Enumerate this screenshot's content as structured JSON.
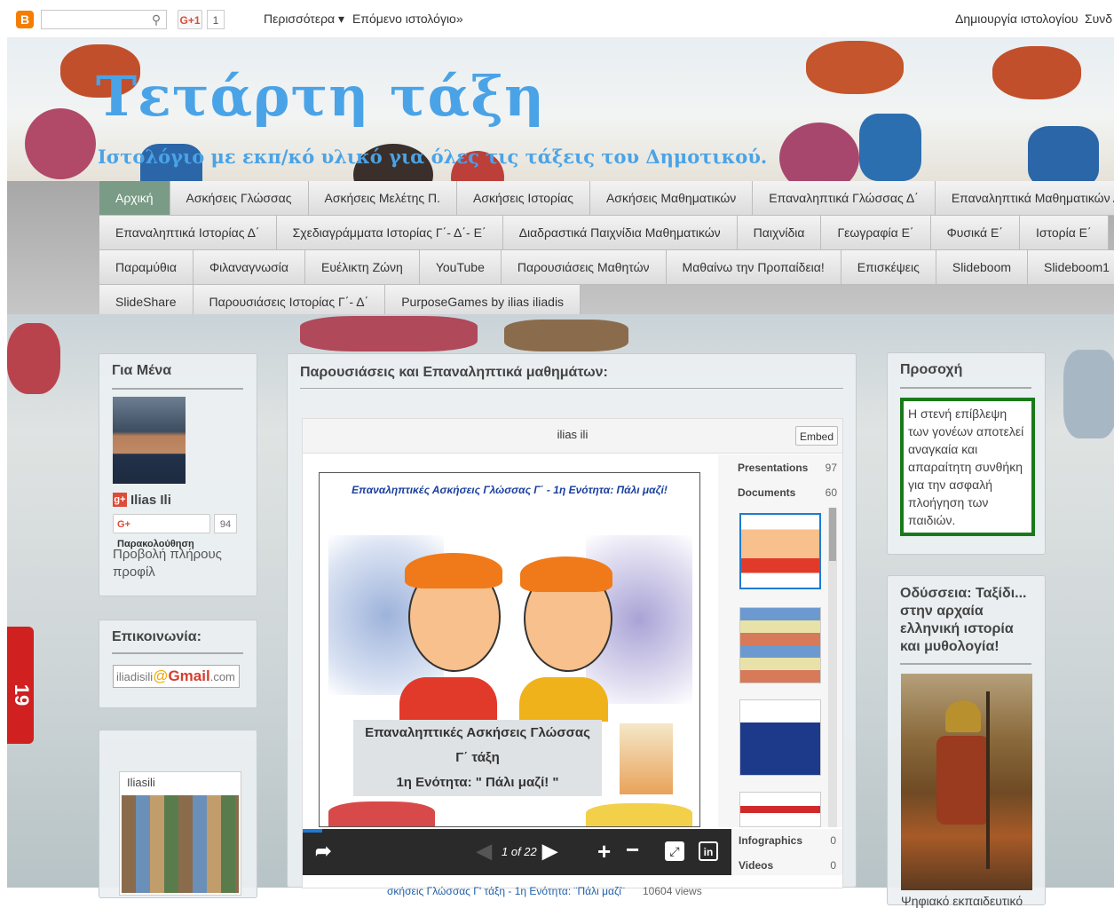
{
  "navbar": {
    "blogger_logo": "B",
    "search_placeholder": "",
    "search_icon": "search-icon",
    "gplus_label": "G+1",
    "gplus_count": "1",
    "more_label": "Περισσότερα ▾",
    "next_blog_label": "Επόμενο ιστολόγιο»",
    "create_blog_label": "Δημιουργία ιστολογίου",
    "signin_label": "Συνδ"
  },
  "header": {
    "title": "Τετάρτη τάξη",
    "description": "Ιστολόγιο με εκπ/κό υλικό για όλες τις τάξεις του Δημοτικού."
  },
  "menu": {
    "rows": [
      [
        "Αρχική",
        "Ασκήσεις Γλώσσας",
        "Ασκήσεις Μελέτης Π.",
        "Ασκήσεις Ιστορίας",
        "Ασκήσεις Μαθηματικών",
        "Επαναληπτικά Γλώσσας Δ΄",
        "Επαναληπτικά Μαθηματικών Δ΄"
      ],
      [
        "Επαναληπτικά Ιστορίας Δ΄",
        "Σχεδιαγράμματα Ιστορίας Γ΄- Δ΄- Ε΄",
        "Διαδραστικά Παιχνίδια Μαθηματικών",
        "Παιχνίδια",
        "Γεωγραφία Ε΄",
        "Φυσικά Ε΄",
        "Ιστορία Ε΄"
      ],
      [
        "Παραμύθια",
        "Φιλαναγνωσία",
        "Ευέλικτη Ζώνη",
        "YouTube",
        "Παρουσιάσεις Μαθητών",
        "Μαθαίνω την Προπαίδεια!",
        "Επισκέψεις",
        "Slideboom",
        "Slideboom1"
      ],
      [
        "SlideShare",
        "Παρουσιάσεις Ιστορίας Γ΄- Δ΄",
        "PurposeGames by ilias iliadis"
      ]
    ],
    "active": "Αρχική"
  },
  "about": {
    "title": "Για Μένα",
    "name": "Ilias Ili",
    "follow_label": "Παρακολούθηση",
    "follow_count": "94",
    "profile_link": "Προβολή πλήρους προφίλ"
  },
  "contact": {
    "title": "Επικοινωνία:",
    "email_user": "iliadisili",
    "email_at": "@",
    "email_domain": "Gmail",
    "email_tld": ".com"
  },
  "photos": {
    "label": "Iliasili"
  },
  "follow_tab": {
    "count": "19"
  },
  "post": {
    "title": "Παρουσιάσεις και Επαναληπτικά μαθημάτων:",
    "slideshare": {
      "author": "ilias ili",
      "embed_label": "Embed",
      "slide_heading": "Επαναληπτικές Ασκήσεις Γλώσσας Γ΄ - 1η Ενότητα: Πάλι μαζί!",
      "slide_line1": "Επαναληπτικές Ασκήσεις Γλώσσας",
      "slide_line2": "Γ΄ τάξη",
      "slide_line3": "1η Ενότητα: \" Πάλι μαζί! \"",
      "page_indicator": "1 of 22",
      "list": [
        {
          "label": "Presentations",
          "count": "97"
        },
        {
          "label": "Documents",
          "count": "60"
        }
      ],
      "list_bottom": [
        {
          "label": "Infographics",
          "count": "0"
        },
        {
          "label": "Videos",
          "count": "0"
        }
      ],
      "footer_title": "σκήσεις Γλώσσας Γ' τάξη - 1η Ενότητα: ¨Πάλι μαζί¨",
      "footer_views": "10604 views"
    }
  },
  "notice": {
    "title": "Προσοχή",
    "text": "Η στενή επίβλεψη των γονέων αποτελεί αναγκαία και απαραίτητη συνθήκη για την ασφαλή πλοήγηση των παιδιών."
  },
  "odyssey": {
    "title": "Οδύσσεια: Ταξίδι... στην αρχαία ελληνική ιστορία και μυθολογία!",
    "caption": "Ψηφιακό εκπαιδευτικό"
  },
  "colors": {
    "title_blue": "#4aa3e6",
    "menu_active": "#7a9b86",
    "notice_border": "#1a7a1a",
    "gplus_red": "#dd4b39",
    "blogger_orange": "#f57d00"
  }
}
